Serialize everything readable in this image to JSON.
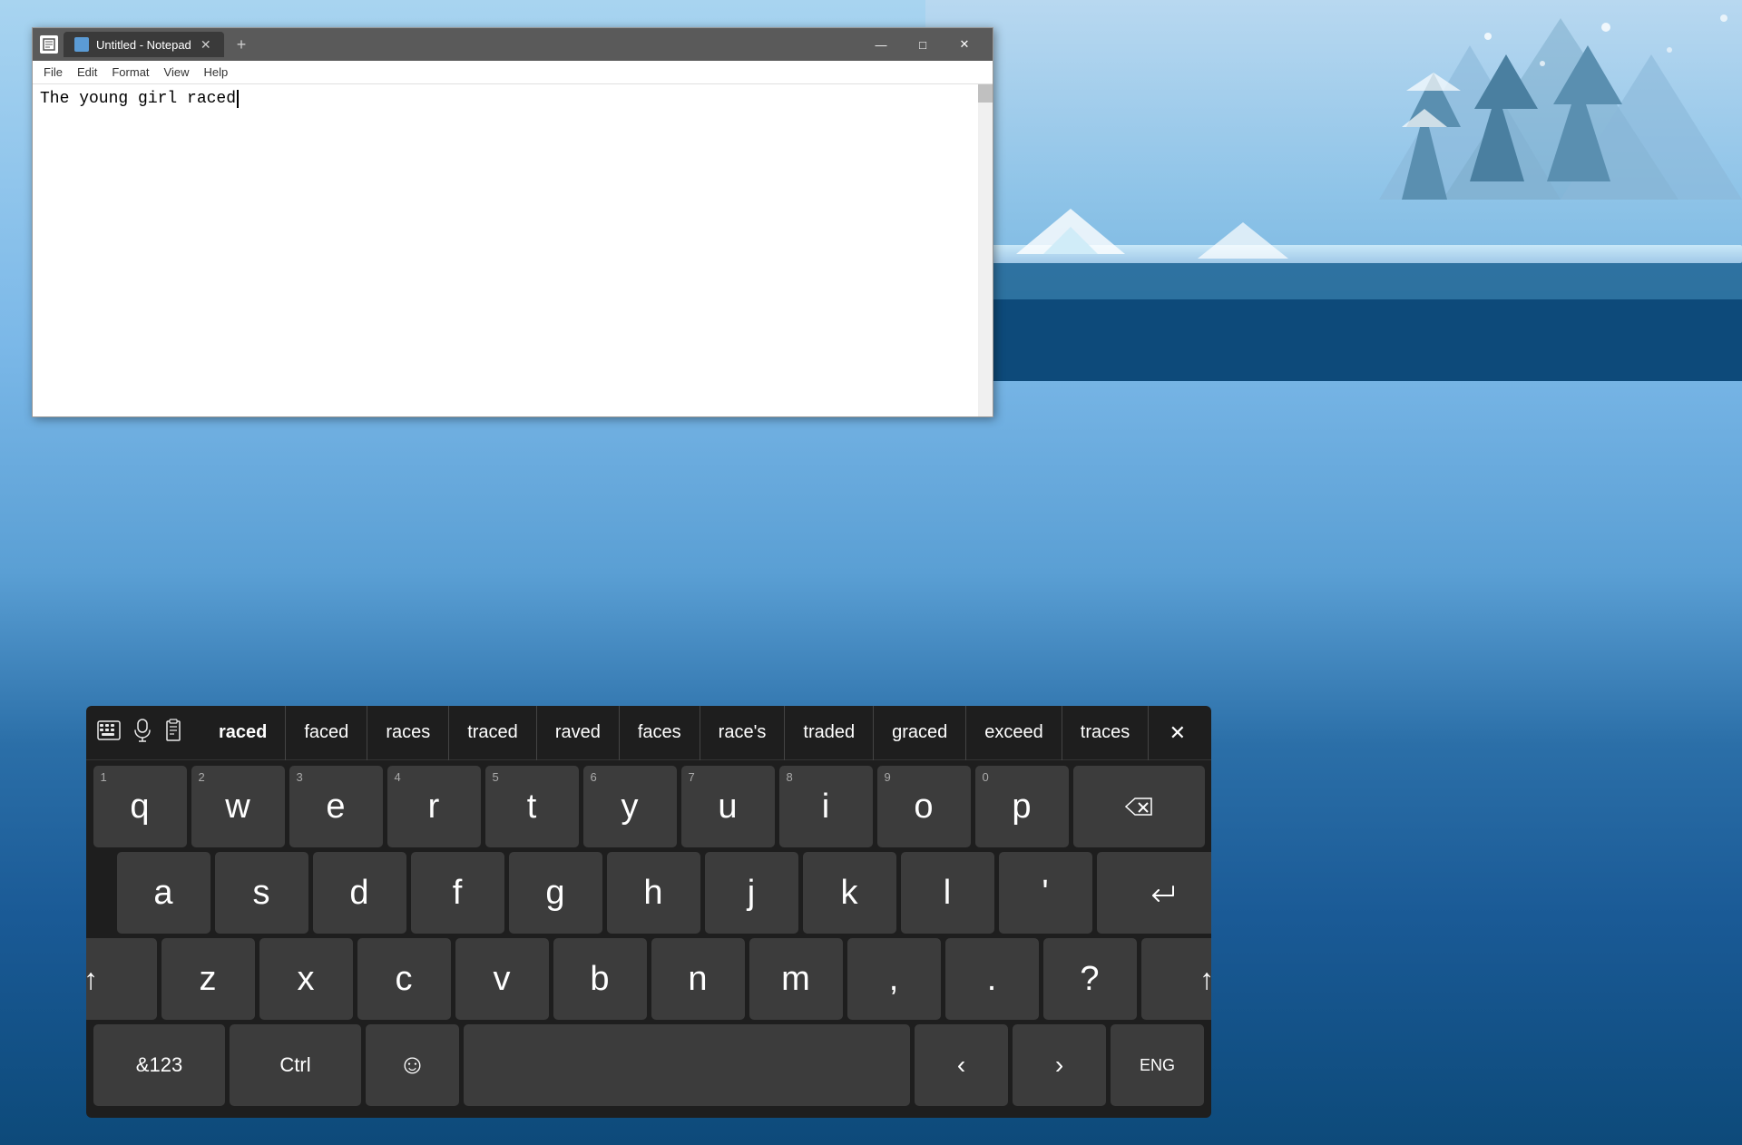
{
  "desktop": {
    "background_color": "#7bb8e8"
  },
  "notepad": {
    "title": "Untitled - Notepad",
    "tab_label": "Untitled - Notepad",
    "content": "The young girl raced",
    "menu_items": [
      "File",
      "Edit",
      "Format",
      "View",
      "Help"
    ],
    "minimize_label": "—",
    "maximize_label": "□",
    "close_label": "✕",
    "new_tab_label": "+"
  },
  "keyboard": {
    "toolbar_icons": [
      "keyboard-icon",
      "mic-icon",
      "clipboard-icon"
    ],
    "close_label": "✕",
    "suggestions": [
      "raced",
      "faced",
      "races",
      "traced",
      "raved",
      "faces",
      "race's",
      "traded",
      "graced",
      "exceed",
      "traces"
    ],
    "selected_suggestion": "raced",
    "rows": [
      {
        "keys": [
          {
            "label": "q",
            "num": "1"
          },
          {
            "label": "w",
            "num": "2"
          },
          {
            "label": "e",
            "num": "3"
          },
          {
            "label": "r",
            "num": "4"
          },
          {
            "label": "t",
            "num": "5"
          },
          {
            "label": "y",
            "num": "6"
          },
          {
            "label": "u",
            "num": "7"
          },
          {
            "label": "i",
            "num": "8"
          },
          {
            "label": "o",
            "num": "9"
          },
          {
            "label": "p",
            "num": "0"
          }
        ],
        "special_end": "⌫"
      },
      {
        "keys": [
          {
            "label": "a"
          },
          {
            "label": "s"
          },
          {
            "label": "d"
          },
          {
            "label": "f"
          },
          {
            "label": "g"
          },
          {
            "label": "h"
          },
          {
            "label": "j"
          },
          {
            "label": "k"
          },
          {
            "label": "l"
          },
          {
            "label": "'"
          }
        ],
        "special_end": "↵"
      },
      {
        "keys": [
          {
            "label": "z"
          },
          {
            "label": "x"
          },
          {
            "label": "c"
          },
          {
            "label": "v"
          },
          {
            "label": "b"
          },
          {
            "label": "n"
          },
          {
            "label": "m"
          },
          {
            "label": ","
          },
          {
            "label": "."
          },
          {
            "label": "?"
          }
        ],
        "special_start": "↑",
        "special_end": "↑"
      }
    ],
    "bottom_row": {
      "symbols_label": "&123",
      "ctrl_label": "Ctrl",
      "emoji_label": "☺",
      "space_label": "",
      "left_arrow": "‹",
      "right_arrow": "›",
      "lang_label": "ENG"
    }
  }
}
